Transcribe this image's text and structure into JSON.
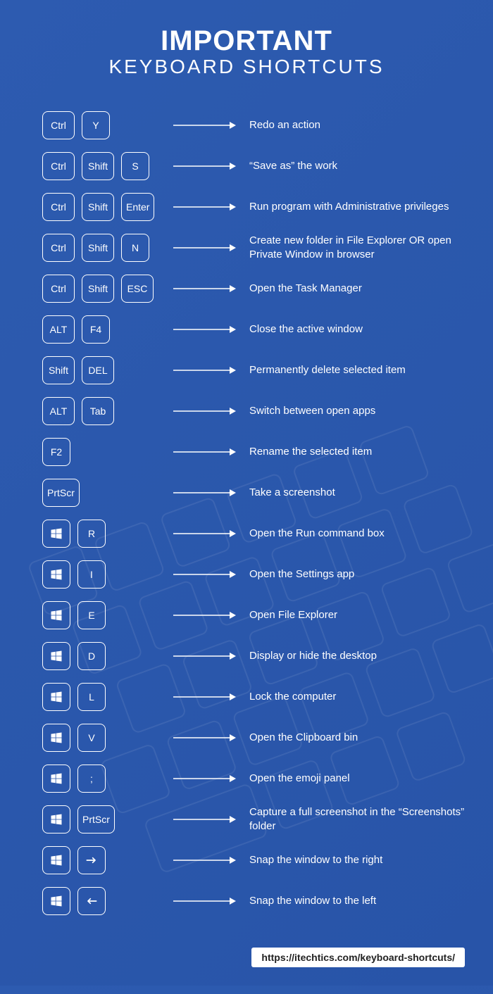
{
  "title_line1": "IMPORTANT",
  "title_line2": "KEYBOARD SHORTCUTS",
  "footer_url": "https://itechtics.com/keyboard-shortcuts/",
  "shortcuts": [
    {
      "keys": [
        "Ctrl",
        "Y"
      ],
      "desc": "Redo an action"
    },
    {
      "keys": [
        "Ctrl",
        "Shift",
        "S"
      ],
      "desc": "“Save as” the work"
    },
    {
      "keys": [
        "Ctrl",
        "Shift",
        "Enter"
      ],
      "desc": "Run program with Administrative privileges"
    },
    {
      "keys": [
        "Ctrl",
        "Shift",
        "N"
      ],
      "desc": "Create new folder in File Explorer OR open Private Window in browser"
    },
    {
      "keys": [
        "Ctrl",
        "Shift",
        "ESC"
      ],
      "desc": "Open the Task Manager"
    },
    {
      "keys": [
        "ALT",
        "F4"
      ],
      "desc": "Close the active window"
    },
    {
      "keys": [
        "Shift",
        "DEL"
      ],
      "desc": "Permanently delete selected item"
    },
    {
      "keys": [
        "ALT",
        "Tab"
      ],
      "desc": "Switch between open apps"
    },
    {
      "keys": [
        "F2"
      ],
      "desc": "Rename the selected item"
    },
    {
      "keys": [
        "PrtScr"
      ],
      "desc": "Take a screenshot"
    },
    {
      "keys": [
        "WIN",
        "R"
      ],
      "desc": "Open the Run command box"
    },
    {
      "keys": [
        "WIN",
        "I"
      ],
      "desc": "Open the Settings app"
    },
    {
      "keys": [
        "WIN",
        "E"
      ],
      "desc": "Open File Explorer"
    },
    {
      "keys": [
        "WIN",
        "D"
      ],
      "desc": "Display or hide the desktop"
    },
    {
      "keys": [
        "WIN",
        "L"
      ],
      "desc": "Lock the computer"
    },
    {
      "keys": [
        "WIN",
        "V"
      ],
      "desc": "Open the Clipboard bin"
    },
    {
      "keys": [
        "WIN",
        ";"
      ],
      "desc": "Open the emoji panel"
    },
    {
      "keys": [
        "WIN",
        "PrtScr"
      ],
      "desc": "Capture a full screenshot in the “Screenshots” folder"
    },
    {
      "keys": [
        "WIN",
        "ARROW_RIGHT"
      ],
      "desc": "Snap the window to the right"
    },
    {
      "keys": [
        "WIN",
        "ARROW_LEFT"
      ],
      "desc": "Snap the window to the left"
    }
  ]
}
